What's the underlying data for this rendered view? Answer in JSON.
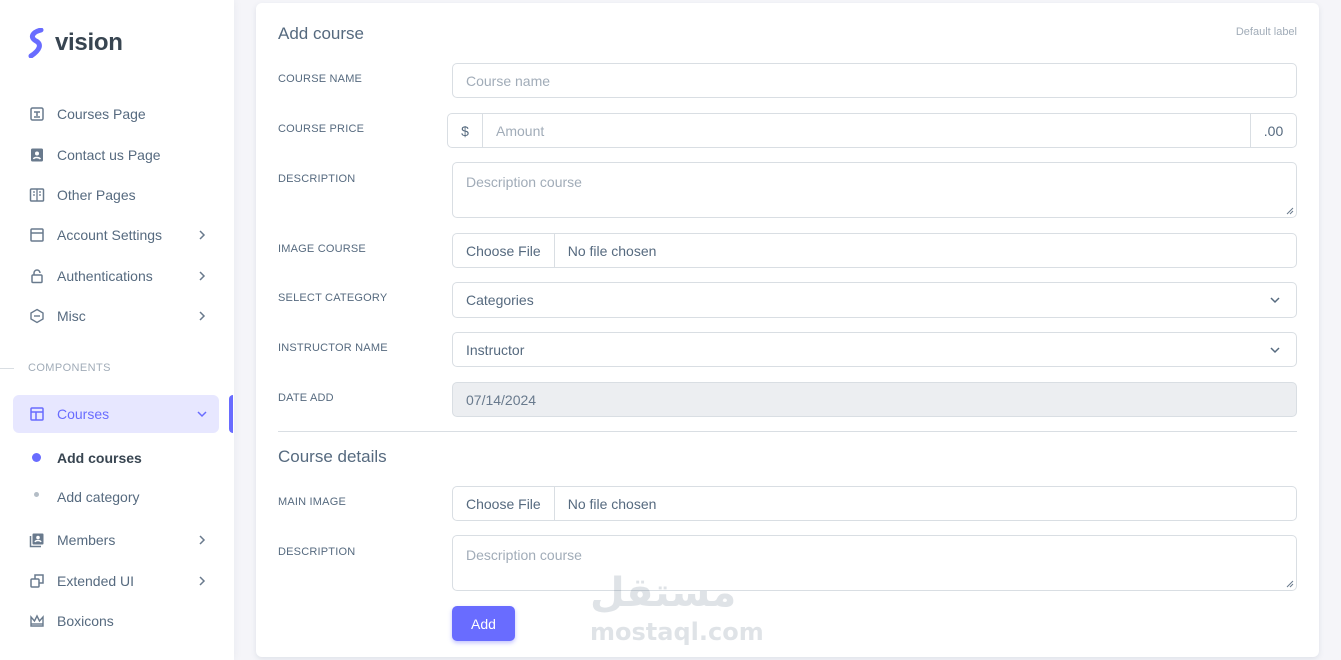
{
  "brand": {
    "name": "vision",
    "accent": "#696cff"
  },
  "sidebar": {
    "items": [
      {
        "label": "Courses Page",
        "icon": "card-icon"
      },
      {
        "label": "Contact us Page",
        "icon": "contact-book-icon"
      },
      {
        "label": "Other Pages",
        "icon": "book-open-icon"
      },
      {
        "label": "Account Settings",
        "icon": "window-icon"
      },
      {
        "label": "Authentications",
        "icon": "lock-icon"
      },
      {
        "label": "Misc",
        "icon": "cube-icon"
      }
    ],
    "section_header": "COMPONENTS",
    "courses": {
      "label": "Courses",
      "icon": "layout-icon"
    },
    "sub_items": [
      {
        "label": "Add courses"
      },
      {
        "label": "Add category"
      }
    ],
    "bottom_items": [
      {
        "label": "Members",
        "icon": "members-icon"
      },
      {
        "label": "Extended UI",
        "icon": "copy-icon"
      },
      {
        "label": "Boxicons",
        "icon": "crown-icon"
      }
    ]
  },
  "form": {
    "title": "Add course",
    "default_label": "Default label",
    "course_name": {
      "label": "COURSE NAME",
      "placeholder": "Course name"
    },
    "course_price": {
      "label": "COURSE PRICE",
      "prefix": "$",
      "placeholder": "Amount",
      "suffix": ".00"
    },
    "description": {
      "label": "DESCRIPTION",
      "placeholder": "Description course"
    },
    "image_course": {
      "label": "IMAGE COURSE",
      "button": "Choose File",
      "file": "No file chosen"
    },
    "category": {
      "label": "SELECT CATEGORY",
      "value": "Categories"
    },
    "instructor": {
      "label": "INSTRUCTOR NAME",
      "value": "Instructor"
    },
    "date_add": {
      "label": "DATE ADD",
      "value": "07/14/2024"
    }
  },
  "details": {
    "title": "Course details",
    "main_image": {
      "label": "MAIN IMAGE",
      "button": "Choose File",
      "file": "No file chosen"
    },
    "description": {
      "label": "DESCRIPTION",
      "placeholder": "Description course"
    },
    "add_button": "Add"
  },
  "watermark": {
    "arabic": "مستقل",
    "latin": "mostaql.com"
  }
}
